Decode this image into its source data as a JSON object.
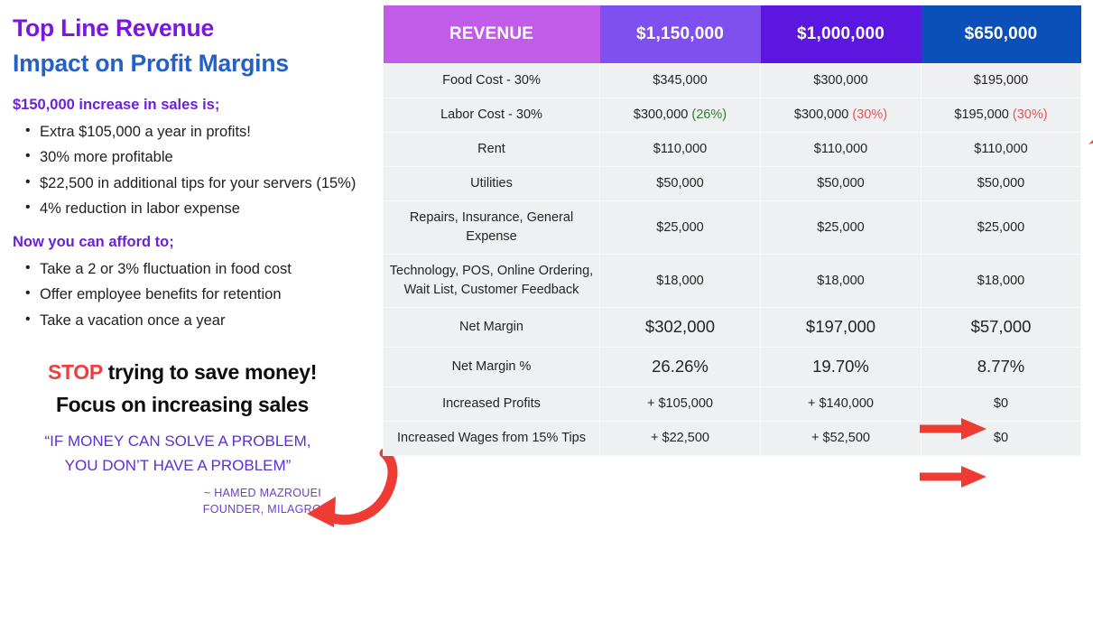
{
  "headline": {
    "line1": "Top Line Revenue",
    "line2": "Impact on Profit Margins"
  },
  "section1": {
    "heading": "$150,000 increase in sales is;",
    "bullets": [
      "Extra $105,000 a year in profits!",
      "30% more profitable",
      "$22,500 in additional tips for your servers (15%)",
      "4% reduction in labor expense"
    ]
  },
  "section2": {
    "heading": "Now you can afford to;",
    "bullets": [
      "Take a 2 or 3% fluctuation in food cost",
      "Offer employee benefits for retention",
      "Take a vacation once a year"
    ]
  },
  "cta": {
    "stop_word": "STOP",
    "line1_rest": " trying to save money!",
    "line2": "Focus on increasing sales"
  },
  "quote": {
    "line1": "“IF MONEY CAN SOLVE A PROBLEM,",
    "line2": "YOU DON’T HAVE A PROBLEM”",
    "attrib_line1": "~ HAMED MAZROUEI",
    "attrib_line2": "FOUNDER, MILAGRO"
  },
  "colors": {
    "headline_purple": "#7916e0",
    "headline_blue": "#2560c8",
    "subhead_purple": "#6b21d4",
    "stop_red": "#f03e3e",
    "quote_purple": "#5b2fd4",
    "header_col0": "#c05ce8",
    "header_col1": "#7f4ff0",
    "header_col2": "#5b16e0",
    "header_col3": "#0b4fb8",
    "arrow_red": "#ee3b33",
    "green": "#2e7d32",
    "red": "#e8535a",
    "magenta": "#d84bc8",
    "row_bg": "#eef0f2"
  },
  "icons": {
    "arrow_diagonal": "arrow-diagonal-down-left-icon",
    "arrow_right_net_margin": "arrow-right-icon",
    "arrow_right_net_margin_pct": "arrow-right-icon",
    "arrow_curved": "arrow-curved-down-left-icon"
  },
  "chart_data": {
    "type": "table",
    "title": "Top Line Revenue Impact on Profit Margins",
    "columns": [
      "REVENUE",
      "$1,150,000",
      "$1,000,000",
      "$650,000"
    ],
    "rows": [
      {
        "label": "Food Cost - 30%",
        "cells": [
          {
            "text": "$345,000",
            "color": "default"
          },
          {
            "text": "$300,000",
            "color": "default"
          },
          {
            "text": "$195,000",
            "color": "default"
          }
        ]
      },
      {
        "label": "Labor Cost - 30%",
        "cells": [
          {
            "text": "$300,000",
            "suffix": "(26%)",
            "suffix_color": "green"
          },
          {
            "text": "$300,000",
            "suffix": "(30%)",
            "suffix_color": "red"
          },
          {
            "text": "$195,000",
            "suffix": "(30%)",
            "suffix_color": "red"
          }
        ]
      },
      {
        "label": "Rent",
        "cells": [
          {
            "text": "$110,000",
            "color": "default"
          },
          {
            "text": "$110,000",
            "color": "default"
          },
          {
            "text": "$110,000",
            "color": "default"
          }
        ]
      },
      {
        "label": "Utilities",
        "cells": [
          {
            "text": "$50,000",
            "color": "default"
          },
          {
            "text": "$50,000",
            "color": "default"
          },
          {
            "text": "$50,000",
            "color": "default"
          }
        ]
      },
      {
        "label": "Repairs, Insurance, General Expense",
        "cells": [
          {
            "text": "$25,000",
            "color": "default"
          },
          {
            "text": "$25,000",
            "color": "default"
          },
          {
            "text": "$25,000",
            "color": "default"
          }
        ]
      },
      {
        "label": "Technology, POS, Online Ordering, Wait List, Customer Feedback",
        "cells": [
          {
            "text": "$18,000",
            "color": "default"
          },
          {
            "text": "$18,000",
            "color": "default"
          },
          {
            "text": "$18,000",
            "color": "default"
          }
        ]
      },
      {
        "label": "Net Margin",
        "emphasis": true,
        "cells": [
          {
            "text": "$302,000",
            "color": "default"
          },
          {
            "text": "$197,000",
            "color": "default"
          },
          {
            "text": "$57,000",
            "color": "default"
          }
        ]
      },
      {
        "label": "Net Margin %",
        "emphasis": true,
        "cells": [
          {
            "text": "26.26%",
            "color": "green"
          },
          {
            "text": "19.70%",
            "color": "default"
          },
          {
            "text": "8.77%",
            "color": "red"
          }
        ]
      },
      {
        "label": "Increased Profits",
        "cells": [
          {
            "text": "+ $105,000",
            "color": "green"
          },
          {
            "text": "+ $140,000",
            "color": "magenta"
          },
          {
            "text": "$0",
            "color": "red"
          }
        ]
      },
      {
        "label": "Increased Wages from 15% Tips",
        "cells": [
          {
            "text": "+ $22,500",
            "color": "green"
          },
          {
            "text": "+ $52,500",
            "color": "magenta"
          },
          {
            "text": "$0",
            "color": "red"
          }
        ]
      }
    ]
  },
  "table": {
    "header": {
      "col0": "REVENUE",
      "col1": "$1,150,000",
      "col2": "$1,000,000",
      "col3": "$650,000"
    },
    "r0": {
      "label": "Food Cost - 30%",
      "c1": "$345,000",
      "c2": "$300,000",
      "c3": "$195,000"
    },
    "r1": {
      "label": "Labor Cost - 30%",
      "c1": "$300,000 ",
      "c1p": "(26%)",
      "c2": "$300,000 ",
      "c2p": "(30%)",
      "c3": "$195,000 ",
      "c3p": "(30%)"
    },
    "r2": {
      "label": "Rent",
      "c1": "$110,000",
      "c2": "$110,000",
      "c3": "$110,000"
    },
    "r3": {
      "label": "Utilities",
      "c1": "$50,000",
      "c2": "$50,000",
      "c3": "$50,000"
    },
    "r4": {
      "label": "Repairs, Insurance, General Expense",
      "c1": "$25,000",
      "c2": "$25,000",
      "c3": "$25,000"
    },
    "r5": {
      "label": "Technology, POS, Online Ordering, Wait List, Customer Feedback",
      "c1": "$18,000",
      "c2": "$18,000",
      "c3": "$18,000"
    },
    "r6": {
      "label": "Net Margin",
      "c1": "$302,000",
      "c2": "$197,000",
      "c3": "$57,000"
    },
    "r7": {
      "label": "Net Margin %",
      "c1": "26.26%",
      "c2": "19.70%",
      "c3": "8.77%"
    },
    "r8": {
      "label": "Increased Profits",
      "c1": "+ $105,000",
      "c2": "+ $140,000",
      "c3": "$0"
    },
    "r9": {
      "label": "Increased Wages from 15% Tips",
      "c1": "+ $22,500",
      "c2": "+ $52,500",
      "c3": "$0"
    }
  }
}
